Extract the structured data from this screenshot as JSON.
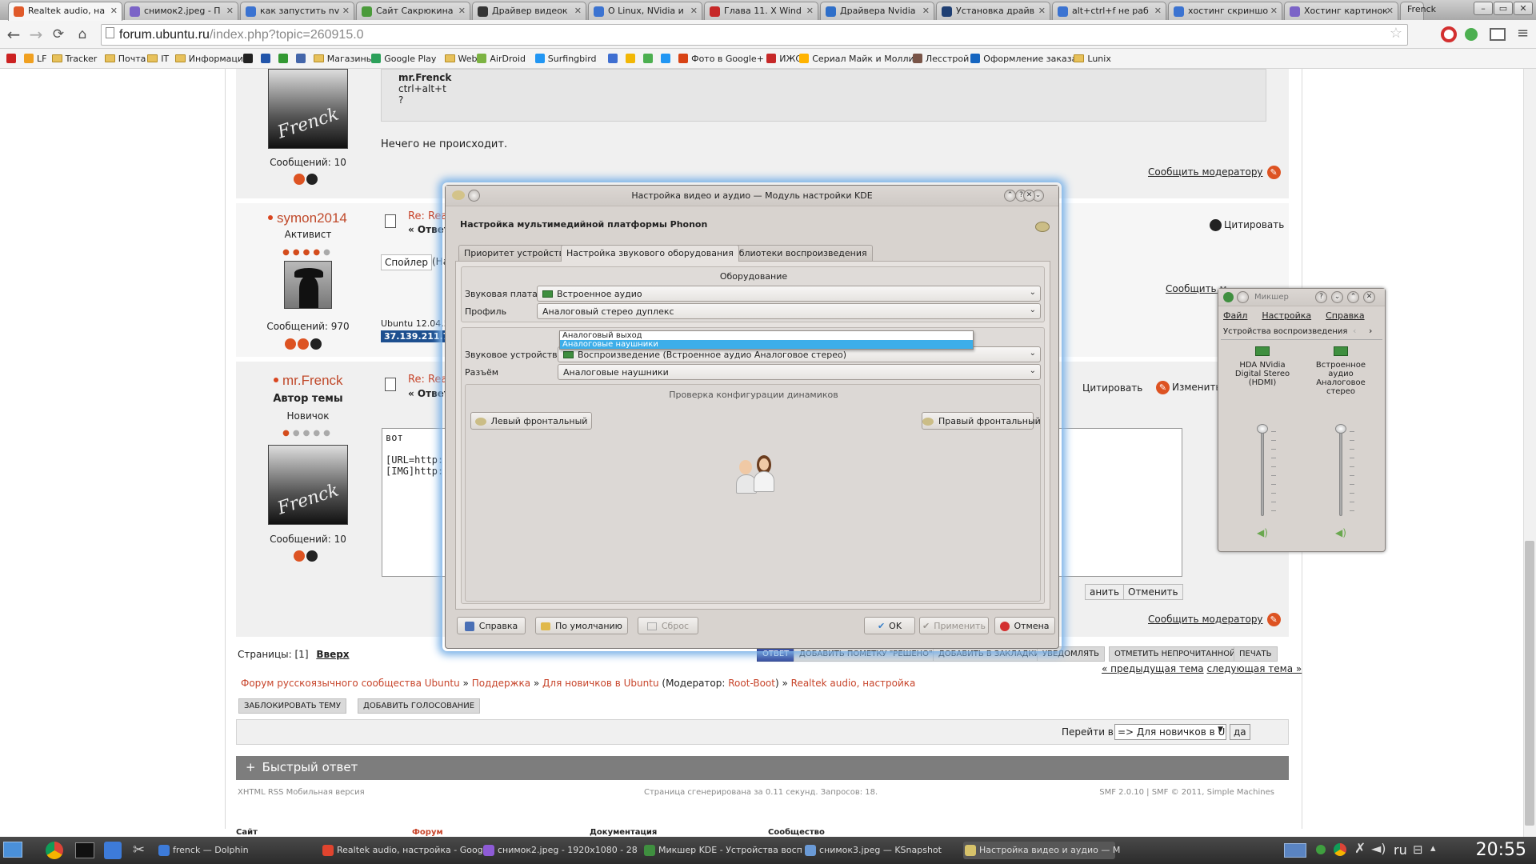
{
  "browser": {
    "tabs": [
      {
        "title": "Realtek audio, на",
        "color": "#e05a2a",
        "active": true
      },
      {
        "title": "снимок2.jpeg - П",
        "color": "#7b63c7"
      },
      {
        "title": "как запустить nv",
        "color": "#3b73d1"
      },
      {
        "title": "Сайт Сакрюкина",
        "color": "#4b9b3b"
      },
      {
        "title": "Драйвер видеок",
        "color": "#333333"
      },
      {
        "title": "О Linux, NVidia и",
        "color": "#3b73d1"
      },
      {
        "title": "Глава 11. X Wind",
        "color": "#c62828"
      },
      {
        "title": "Драйвера Nvidia",
        "color": "#2f6fc9"
      },
      {
        "title": "Установка драйв",
        "color": "#1f3f73"
      },
      {
        "title": "alt+ctrl+f не раб",
        "color": "#3b73d1"
      },
      {
        "title": "хостинг скриншо",
        "color": "#3b73d1"
      },
      {
        "title": "Хостинг картинок",
        "color": "#7b63c7"
      }
    ],
    "profile": "Frenck",
    "url_host": "forum.ubuntu.ru",
    "url_path": "/index.php?topic=260915.0",
    "bookmarks": [
      {
        "label": "",
        "type": "icon",
        "color": "#cc2222"
      },
      {
        "label": "LF",
        "type": "icon",
        "color": "#f0a020"
      },
      {
        "label": "Tracker",
        "type": "folder"
      },
      {
        "label": "Почта",
        "type": "folder"
      },
      {
        "label": "IT",
        "type": "folder"
      },
      {
        "label": "Информация",
        "type": "folder"
      },
      {
        "label": "",
        "type": "icon",
        "color": "#222222"
      },
      {
        "label": "",
        "type": "icon",
        "color": "#2255aa"
      },
      {
        "label": "",
        "type": "icon",
        "color": "#339933"
      },
      {
        "label": "",
        "type": "icon",
        "color": "#4466aa"
      },
      {
        "label": "Магазины",
        "type": "folder"
      },
      {
        "label": "Google Play",
        "type": "icon",
        "color": "#2ca05a"
      },
      {
        "label": "Web",
        "type": "folder"
      },
      {
        "label": "AirDroid",
        "type": "icon",
        "color": "#7cb342"
      },
      {
        "label": "Surfingbird",
        "type": "icon",
        "color": "#2196f3"
      },
      {
        "label": "",
        "type": "icon",
        "color": "#3f6fd1"
      },
      {
        "label": "",
        "type": "icon",
        "color": "#f2b705"
      },
      {
        "label": "",
        "type": "icon",
        "color": "#4caf50"
      },
      {
        "label": "",
        "type": "icon",
        "color": "#2196f3"
      },
      {
        "label": "Фото в Google+",
        "type": "icon",
        "color": "#d84315"
      },
      {
        "label": "ИЖС",
        "type": "icon",
        "color": "#c62828"
      },
      {
        "label": "Сериал Майк и Молли",
        "type": "icon",
        "color": "#ffb300"
      },
      {
        "label": "Лесстрой",
        "type": "icon",
        "color": "#795548"
      },
      {
        "label": "Оформление заказа",
        "type": "icon",
        "color": "#1565c0"
      },
      {
        "label": "Lunix",
        "type": "folder"
      }
    ]
  },
  "forum": {
    "post1": {
      "quote_author": "mr.Frenck",
      "quote_line1": "ctrl+alt+t",
      "quote_line2": "?",
      "text": "Нечего не происходит.",
      "posts_count": "Сообщений: 10",
      "report": "Сообщить модератору"
    },
    "post2": {
      "user": "symon2014",
      "rank": "Активист",
      "posts_count": "Сообщений: 970",
      "subject": "Re: Rea",
      "reply_label": "« Ответ",
      "quote_btn": "Цитировать",
      "spoiler": "Спойлер",
      "spoiler_tail": "(На",
      "report": "Сообщить м",
      "sig_line": "Ubuntu 12.04.5",
      "ip": "37.139.211.75"
    },
    "post3": {
      "user": "mr.Frenck",
      "author_label": "Автор темы",
      "rank": "Новичок",
      "posts_count": "Сообщений: 10",
      "subject": "Re: Rea",
      "reply_label": "« Ответ",
      "quote_btn": "Цитировать",
      "edit_btn": "Изменить",
      "editor_line1": "вот",
      "editor_line2": "[URL=http:",
      "editor_line3": "[IMG]http:",
      "save_btn": "анить",
      "cancel_btn": "Отменить",
      "report": "Сообщить модератору"
    },
    "pages_label": "Страницы:",
    "pages_value": "[1]",
    "top_link": "Вверх",
    "actions": [
      "ОТВЕТ",
      "ДОБАВИТЬ ПОМЕТКУ \"РЕШЕНО\"",
      "ДОБАВИТЬ В ЗАКЛАДКИ",
      "УВЕДОМЛЯТЬ",
      "ОТМЕТИТЬ НЕПРОЧИТАННОЙ",
      "ПЕЧАТЬ"
    ],
    "prev_topic": "« предыдущая тема",
    "next_topic": "следующая тема »",
    "breadcrumb": {
      "b1": "Форум русскоязычного сообщества Ubuntu",
      "b2": "Поддержка",
      "b3": "Для новичков в Ubuntu",
      "mod_prefix": "(Модератор:",
      "mod_name": "Root-Boot",
      "mod_suffix": ")",
      "b4": "Realtek audio, настройка"
    },
    "lock_btn": "ЗАБЛОКИРОВАТЬ ТЕМУ",
    "poll_btn": "ДОБАВИТЬ ГОЛОСОВАНИЕ",
    "jump_label": "Перейти в:",
    "jump_value": "=> Для новичков в Ubuntu",
    "jump_go": "да",
    "quick_reply": "Быстрый ответ",
    "footer_left": "XHTML   RSS   Мобильная версия",
    "footer_mid": "Страница сгенерирована за 0.11 секунд. Запросов: 18.",
    "footer_right": "SMF 2.0.10 | SMF © 2011, Simple Machines",
    "bottom_cols": [
      "Сайт",
      "Форум",
      "Документация",
      "Сообщество"
    ]
  },
  "kde": {
    "title": "Настройка видео и аудио — Модуль настройки KDE",
    "heading": "Настройка мультимедийной платформы Phonon",
    "tabs": [
      "Приоритет устройств",
      "Настройка звукового оборудования",
      "Библиотеки воспроизведения"
    ],
    "hw_group": "Оборудование",
    "card_label": "Звуковая плата",
    "card_value": "Встроенное аудио",
    "profile_label": "Профиль",
    "profile_value": "Аналоговый стерео дуплекс",
    "dev_group": "Настройка устройства",
    "device_label": "Звуковое устройство",
    "device_value": "Воспроизведение (Встроенное аудио Аналоговое стерео)",
    "connector_label": "Разъём",
    "connector_value": "Аналоговые наушники",
    "dropdown_options": [
      "Аналоговый выход",
      "Аналоговые наушники"
    ],
    "test_group": "Проверка конфигурации динамиков",
    "left_btn": "Левый фронтальный",
    "right_btn": "Правый фронтальный",
    "help_btn": "Справка",
    "defaults_btn": "По умолчанию",
    "reset_btn": "Сброс",
    "ok_btn": "OK",
    "apply_btn": "Применить",
    "cancel_btn": "Отмена"
  },
  "mixer": {
    "title": "Микшер",
    "menu": [
      "Файл",
      "Настройка",
      "Справка"
    ],
    "tab": "Устройства воспроизведения",
    "channels": [
      {
        "name": "HDA NVidia Digital Stereo (HDMI)",
        "level": 0
      },
      {
        "name": "Встроенное аудио Аналоговое стерео",
        "level": 0
      }
    ]
  },
  "taskbar": {
    "tasks": [
      {
        "label": "frenck — Dolphin",
        "color": "#3d7bd9"
      },
      {
        "label": "Realtek audio, настройка - Goog",
        "color": "#e0442e"
      },
      {
        "label": "снимок2.jpeg - 1920x1080 - 28",
        "color": "#8e5bd6"
      },
      {
        "label": "Микшер KDE - Устройства восп",
        "color": "#3f8f3f"
      },
      {
        "label": "снимок3.jpeg — KSnapshot",
        "color": "#6a9ad6"
      },
      {
        "label": "Настройка видео и аудио — М",
        "color": "#d6c26a"
      }
    ],
    "lang": "ru",
    "time": "20:55"
  }
}
